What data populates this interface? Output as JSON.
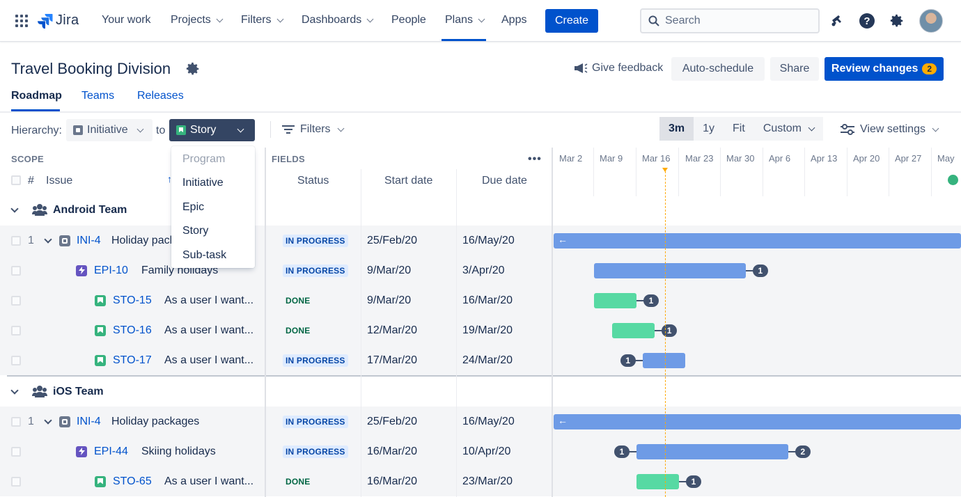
{
  "nav": {
    "logo_text": "Jira",
    "your_work": "Your work",
    "projects": "Projects",
    "filters": "Filters",
    "dashboards": "Dashboards",
    "people": "People",
    "plans": "Plans",
    "apps": "Apps",
    "create": "Create",
    "search_placeholder": "Search"
  },
  "header": {
    "title": "Travel Booking Division",
    "give_feedback": "Give feedback",
    "auto_schedule": "Auto-schedule",
    "share": "Share",
    "review_changes": "Review changes",
    "review_count": "2"
  },
  "tabs": [
    "Roadmap",
    "Teams",
    "Releases"
  ],
  "toolbar": {
    "hierarchy_label": "Hierarchy:",
    "from_level": "Initiative",
    "to_label": "to",
    "to_level": "Story",
    "filters": "Filters",
    "ranges": [
      "3m",
      "1y",
      "Fit",
      "Custom"
    ],
    "active_range": "3m",
    "view_settings": "View settings"
  },
  "columns": {
    "scope": "SCOPE",
    "fields": "FIELDS",
    "more": "•••",
    "num": "#",
    "issue": "Issue",
    "status": "Status",
    "start_date": "Start date",
    "due_date": "Due date"
  },
  "timeline_dates": [
    "Mar 2",
    "Mar 9",
    "Mar 16",
    "Mar 23",
    "Mar 30",
    "Apr 6",
    "Apr 13",
    "Apr 20",
    "Apr 27",
    "May"
  ],
  "hierarchy_dropdown": {
    "items": [
      "Program",
      "Initiative",
      "Epic",
      "Story",
      "Sub-task"
    ],
    "disabled": "Program"
  },
  "teams": [
    {
      "name": "Android Team",
      "rows": [
        {
          "num": "1",
          "key": "INI-4",
          "summary": "Holiday packages",
          "status": "IN PROGRESS",
          "start": "25/Feb/20",
          "due": "16/May/20"
        },
        {
          "num": "",
          "key": "EPI-10",
          "summary": "Family holidays",
          "status": "IN PROGRESS",
          "start": "9/Mar/20",
          "due": "3/Apr/20",
          "dep_after": "1"
        },
        {
          "num": "",
          "key": "STO-15",
          "summary": "As a user I want...",
          "status": "DONE",
          "start": "9/Mar/20",
          "due": "16/Mar/20",
          "dep_after": "1"
        },
        {
          "num": "",
          "key": "STO-16",
          "summary": "As a user I want...",
          "status": "DONE",
          "start": "12/Mar/20",
          "due": "19/Mar/20",
          "dep_after": "1"
        },
        {
          "num": "",
          "key": "STO-17",
          "summary": "As a user I want...",
          "status": "IN PROGRESS",
          "start": "17/Mar/20",
          "due": "24/Mar/20",
          "dep_before": "1"
        }
      ]
    },
    {
      "name": "iOS Team",
      "rows": [
        {
          "num": "1",
          "key": "INI-4",
          "summary": "Holiday packages",
          "status": "IN PROGRESS",
          "start": "25/Feb/20",
          "due": "16/May/20"
        },
        {
          "num": "",
          "key": "EPI-44",
          "summary": "Skiing holidays",
          "status": "IN PROGRESS",
          "start": "16/Mar/20",
          "due": "10/Apr/20",
          "dep_before": "1",
          "dep_after": "2"
        },
        {
          "num": "",
          "key": "STO-65",
          "summary": "As a user I want...",
          "status": "DONE",
          "start": "16/Mar/20",
          "due": "23/Mar/20",
          "dep_after": "1"
        }
      ]
    }
  ],
  "colors": {
    "primary": "#0052cc",
    "bar_blue": "#6e9be6",
    "bar_green": "#57d9a3",
    "today": "#ffab00"
  },
  "icons": [
    "app-switcher-icon",
    "jira-logo-icon",
    "search-icon",
    "notification-icon",
    "help-icon",
    "settings-icon",
    "gear-icon",
    "megaphone-icon",
    "filter-icon",
    "sliders-icon",
    "team-icon",
    "initiative-icon",
    "epic-icon",
    "story-icon"
  ]
}
